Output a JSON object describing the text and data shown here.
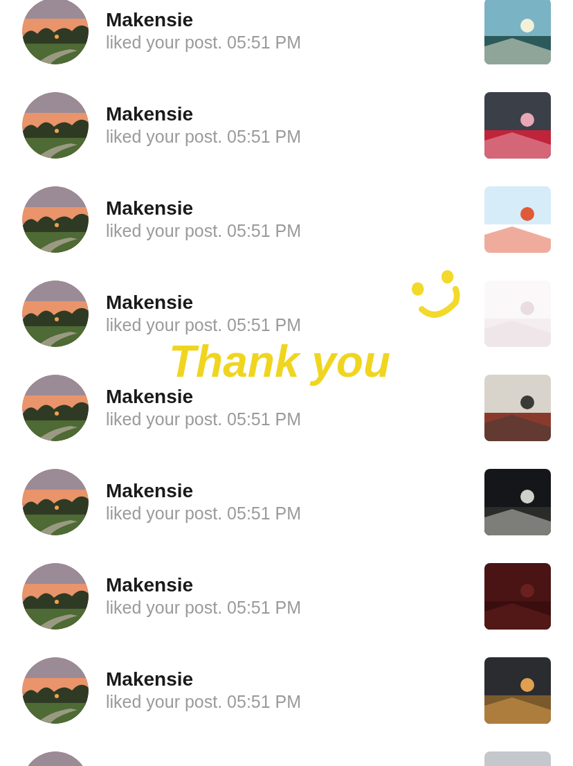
{
  "notifications": [
    {
      "name": "Makensie",
      "text": "liked your post. 05:51 PM",
      "avatar": {
        "kind": "picture"
      },
      "thumbnail": {
        "kind": "picture"
      }
    },
    {
      "name": "Makensie",
      "text": "liked your post. 05:51 PM",
      "avatar": {
        "kind": "picture"
      },
      "thumbnail": {
        "kind": "picture"
      }
    },
    {
      "name": "Makensie",
      "text": "liked your post. 05:51 PM",
      "avatar": {
        "kind": "picture"
      },
      "thumbnail": {
        "kind": "picture"
      }
    },
    {
      "name": "Makensie",
      "text": "liked your post. 05:51 PM",
      "avatar": {
        "kind": "picture"
      },
      "thumbnail": {
        "kind": "picture"
      }
    },
    {
      "name": "Makensie",
      "text": "liked your post. 05:51 PM",
      "avatar": {
        "kind": "picture"
      },
      "thumbnail": {
        "kind": "picture"
      }
    },
    {
      "name": "Makensie",
      "text": "liked your post. 05:51 PM",
      "avatar": {
        "kind": "picture"
      },
      "thumbnail": {
        "kind": "picture"
      }
    },
    {
      "name": "Makensie",
      "text": "liked your post. 05:51 PM",
      "avatar": {
        "kind": "picture"
      },
      "thumbnail": {
        "kind": "picture"
      }
    },
    {
      "name": "Makensie",
      "text": "liked your post. 05:51 PM",
      "avatar": {
        "kind": "picture"
      },
      "thumbnail": {
        "kind": "picture"
      }
    },
    {
      "avatar": {
        "kind": "picture"
      },
      "thumbnail": {
        "kind": "picture"
      }
    }
  ],
  "sticker": {
    "text": "Thank you"
  }
}
